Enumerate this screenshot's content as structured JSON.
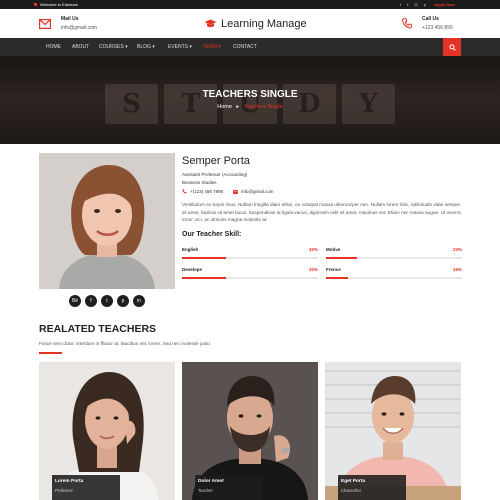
{
  "topbar": {
    "welcome": "Welcome to Edulearn",
    "apply": "Apply Now",
    "social_icons": [
      "facebook-icon",
      "twitter-icon",
      "instagram-icon",
      "pinterest-icon"
    ]
  },
  "header": {
    "mail": {
      "title": "Mail Us",
      "value": "info@gmail.com"
    },
    "brand": "Learning Manage",
    "call": {
      "title": "Call Us",
      "value": "+123 456 890"
    }
  },
  "nav": {
    "items": [
      {
        "label": "HOME"
      },
      {
        "label": "ABOUT"
      },
      {
        "label": "COURSES ▾"
      },
      {
        "label": "BLOG ▾"
      },
      {
        "label": "EVENTS ▾"
      },
      {
        "label": "TEAM ▾"
      },
      {
        "label": "CONTACT"
      }
    ],
    "active_label": "TEAM ▾"
  },
  "banner": {
    "title": "TEACHERS SINGLE",
    "background_letters": [
      "S",
      "T",
      "U",
      "D",
      "Y"
    ],
    "breadcrumb": {
      "home": "Home",
      "separator": "▸",
      "current": "Teachers Single"
    }
  },
  "profile": {
    "name": "Semper Porta",
    "role": "Assistant Professor (Accounting)",
    "department": "Business Studies",
    "phone": "+(123) 456 7890",
    "email": "info@gmail.com",
    "bio": "Vestibulum eu turpis risus. Nullam fringilla diam tellus, eu volutpat massa ullamcorper non. Nullam lorem felis, sollicitudin vitae semper sit amet, facilisis sit amet lacus. Suspendisse at ligula varius, dignissim velit sit amet, maximus est. Etiam nec massa augue. Ut viverra tortor orci, ac ultricies magna molestie at.",
    "skill_title": "Our Teacher Skill:",
    "skills": [
      {
        "label": "English",
        "percent_text": "32%",
        "percent": 32
      },
      {
        "label": "Motive",
        "percent_text": "23%",
        "percent": 23
      },
      {
        "label": "Develope",
        "percent_text": "32%",
        "percent": 32
      },
      {
        "label": "Frence",
        "percent_text": "16%",
        "percent": 16
      }
    ],
    "social_icons": [
      "behance-icon",
      "facebook-icon",
      "twitter-icon",
      "pinterest-icon",
      "linkedin-icon"
    ]
  },
  "related": {
    "title": "REALATED TEACHERS",
    "subtitle": "Fusce sem dolor, interdum in fficitur at, faucibus nec lorem. Sed nec molestie justo.",
    "teachers": [
      {
        "name": "Lorem Porta",
        "role": "Professor"
      },
      {
        "name": "Dolor Amet",
        "role": "Teacher"
      },
      {
        "name": "Eget Porta",
        "role": "Chancellor"
      }
    ]
  },
  "colors": {
    "accent": "#e53226",
    "dark": "#1c1c1c",
    "nav": "#2b2b2b"
  }
}
